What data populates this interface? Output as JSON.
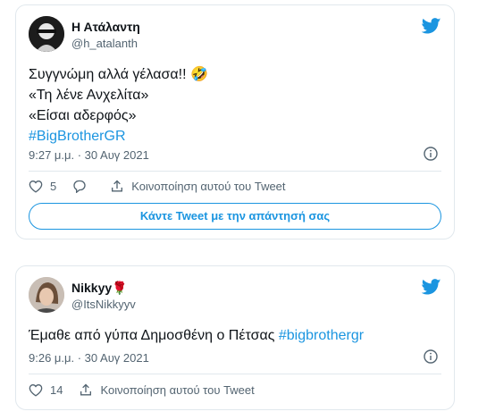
{
  "tweets": [
    {
      "author": "Η Ατάλαντη",
      "handle": "@h_atalanth",
      "lines": [
        "Συγγνώμη αλλά γέλασα!! 🤣",
        "«Τη λένε Ανχελίτα»",
        "«Είσαι αδερφός»"
      ],
      "hashtag": "#BigBrotherGR",
      "timestamp": "9:27 μ.μ. · 30 Αυγ 2021",
      "likes": "5",
      "share_label": "Κοινοποίηση αυτού του Tweet",
      "reply_label": "Κάντε Tweet με την απάντησή σας"
    },
    {
      "author": "Nikkyy🌹",
      "handle": "@ItsNikkyyv",
      "text": "Έμαθε από γύπα Δημοσθένη ο Πέτσας",
      "hashtag": "#bigbrothergr",
      "timestamp": "9:26 μ.μ. · 30 Αυγ 2021",
      "likes": "14",
      "share_label": "Κοινοποίηση αυτού του Tweet"
    }
  ],
  "colors": {
    "accent": "#1b95e0",
    "muted": "#536471",
    "border": "#e1e8ed"
  },
  "icons": [
    "twitter-bird-icon",
    "info-icon",
    "heart-icon",
    "reply-icon",
    "share-icon"
  ]
}
